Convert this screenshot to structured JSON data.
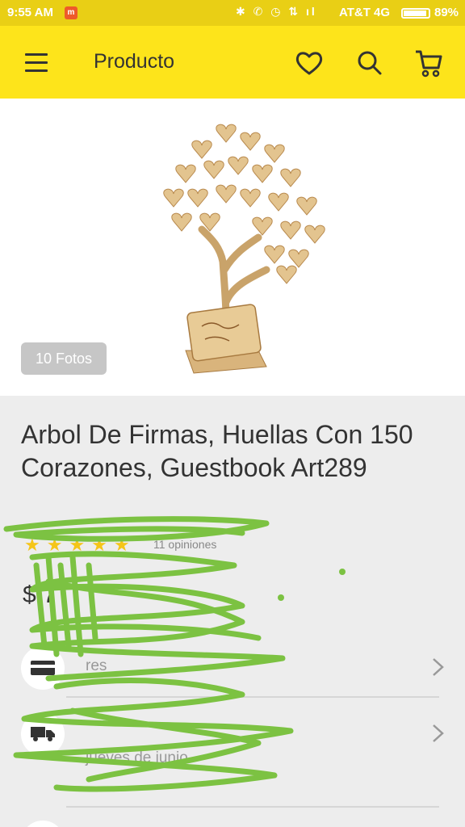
{
  "status_bar": {
    "time": "9:55 AM",
    "carrier": "AT&T 4G",
    "battery_percent": "89%",
    "notification_badge": "m"
  },
  "app_bar": {
    "title": "Producto",
    "icons": [
      "menu-icon",
      "heart-icon",
      "search-icon",
      "cart-icon"
    ]
  },
  "gallery": {
    "photo_count_label": "10 Fotos"
  },
  "product": {
    "title": "Arbol De Firmas, Huellas Con 150 Corazones, Guestbook Art289",
    "rating_stars": "★★★★★",
    "reviews_label": "11 opiniones",
    "price": "$ 7"
  },
  "rows": {
    "payment": {
      "label": "res",
      "icon": "card-icon"
    },
    "shipping": {
      "label": "",
      "sublabel": "jueves de junio",
      "icon": "truck-icon"
    }
  },
  "colors": {
    "brand_yellow": "#fde41b",
    "status_bar": "#e9cf15",
    "scribble_green": "#7cc242"
  }
}
